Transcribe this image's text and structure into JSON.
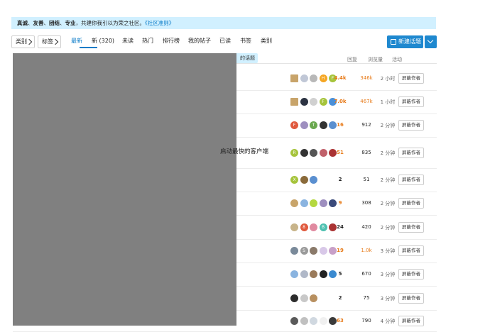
{
  "banner": {
    "w1": "真诚",
    "sep1": "、",
    "w2": "友善",
    "sep2": "、",
    "w3": "团结",
    "sep3": "、",
    "w4": "专业",
    "text": "，共建你我引以为荣之社区。",
    "link": "《社区准则》"
  },
  "nav": {
    "category": "类别",
    "tags": "标签",
    "tabs": [
      "最新",
      "新 (320)",
      "未读",
      "热门",
      "排行榜",
      "我的帖子",
      "已读",
      "书签",
      "类别"
    ],
    "active_tab": "最新"
  },
  "new_topic": "新建话题",
  "hint": "的话题",
  "columns": {
    "replies": "回复",
    "views": "浏览量",
    "activity": "活动"
  },
  "block_label": "屏蔽作者",
  "colors": {
    "accent": "#0a7bc8",
    "hot": "#e77a18",
    "banner_bg": "#d1f0ff",
    "redaction": "#808080"
  },
  "rows": [
    {
      "title": "",
      "replies": "4.4k",
      "views": "346k",
      "activity": "2 小时",
      "replies_hot": true,
      "views_hot": true,
      "avatars": [
        {
          "c": "#c8a46a",
          "t": "",
          "sq": true
        },
        {
          "c": "#c0c7d6",
          "t": ""
        },
        {
          "c": "#b8b8b8",
          "t": ""
        },
        {
          "c": "#f5a623",
          "t": "H"
        },
        {
          "c": "#a6c43c",
          "t": "F"
        }
      ]
    },
    {
      "title": "",
      "replies": "7.0k",
      "views": "467k",
      "activity": "1 小时",
      "replies_hot": true,
      "views_hot": true,
      "avatars": [
        {
          "c": "#c8a46a",
          "t": "",
          "sq": true
        },
        {
          "c": "#2c3342",
          "t": ""
        },
        {
          "c": "#d0d0d0",
          "t": ""
        },
        {
          "c": "#a6c43c",
          "t": "F"
        },
        {
          "c": "#4a90d9",
          "t": ""
        }
      ]
    },
    {
      "title": "",
      "replies": "16",
      "views": "912",
      "activity": "2 分钟",
      "replies_hot": true,
      "views_hot": false,
      "avatars": [
        {
          "c": "#e05a3e",
          "t": "F"
        },
        {
          "c": "#9e8fbf",
          "t": ""
        },
        {
          "c": "#6aa84f",
          "t": "T"
        },
        {
          "c": "#333333",
          "t": ""
        },
        {
          "c": "#5a8fd0",
          "t": ""
        }
      ]
    },
    {
      "title": "启动最快的客户端",
      "replies": "51",
      "views": "835",
      "activity": "2 分钟",
      "replies_hot": true,
      "views_hot": false,
      "avatars": [
        {
          "c": "#a6c43c",
          "t": "R"
        },
        {
          "c": "#333333",
          "t": ""
        },
        {
          "c": "#555555",
          "t": ""
        },
        {
          "c": "#c0606a",
          "t": ""
        },
        {
          "c": "#aa3333",
          "t": ""
        }
      ]
    },
    {
      "title": "",
      "replies": "2",
      "views": "51",
      "activity": "2 分钟",
      "replies_hot": false,
      "views_hot": false,
      "avatars": [
        {
          "c": "#a6c43c",
          "t": "X"
        },
        {
          "c": "#8a6a3a",
          "t": ""
        },
        {
          "c": "#5a8fd0",
          "t": ""
        }
      ]
    },
    {
      "title": "",
      "replies": "9",
      "views": "308",
      "activity": "2 分钟",
      "replies_hot": true,
      "views_hot": false,
      "avatars": [
        {
          "c": "#c8a46a",
          "t": ""
        },
        {
          "c": "#8ab4e0",
          "t": ""
        },
        {
          "c": "#b5d840",
          "t": ""
        },
        {
          "c": "#9e8fbf",
          "t": ""
        },
        {
          "c": "#3a4a7a",
          "t": ""
        }
      ]
    },
    {
      "title": "",
      "replies": "24",
      "views": "420",
      "activity": "2 分钟",
      "replies_hot": false,
      "views_hot": false,
      "avatars": [
        {
          "c": "#c8b48a",
          "t": ""
        },
        {
          "c": "#e05a3e",
          "t": "8"
        },
        {
          "c": "#e08aa0",
          "t": ""
        },
        {
          "c": "#4ec0b0",
          "t": "B"
        },
        {
          "c": "#aa3333",
          "t": ""
        }
      ]
    },
    {
      "title": "",
      "replies": "19",
      "views": "1.0k",
      "activity": "3 分钟",
      "replies_hot": true,
      "views_hot": true,
      "avatars": [
        {
          "c": "#7a8a9a",
          "t": ""
        },
        {
          "c": "#9a9a9a",
          "t": "S"
        },
        {
          "c": "#8a7a6a",
          "t": ""
        },
        {
          "c": "#d8c8e8",
          "t": ""
        },
        {
          "c": "#c8a0c8",
          "t": ""
        }
      ]
    },
    {
      "title": "",
      "replies": "5",
      "views": "670",
      "activity": "3 分钟",
      "replies_hot": false,
      "views_hot": false,
      "avatars": [
        {
          "c": "#8ab4e0",
          "t": ""
        },
        {
          "c": "#b0b8c8",
          "t": ""
        },
        {
          "c": "#9a7a5a",
          "t": ""
        },
        {
          "c": "#222222",
          "t": ""
        },
        {
          "c": "#3a8ad0",
          "t": ""
        }
      ]
    },
    {
      "title": "",
      "replies": "2",
      "views": "75",
      "activity": "3 分钟",
      "replies_hot": false,
      "views_hot": false,
      "avatars": [
        {
          "c": "#2c2c2c",
          "t": ""
        },
        {
          "c": "#c8c8c8",
          "t": ""
        },
        {
          "c": "#b89060",
          "t": ""
        }
      ]
    },
    {
      "title": "",
      "replies": "63",
      "views": "790",
      "activity": "4 分钟",
      "replies_hot": true,
      "views_hot": false,
      "avatars": [
        {
          "c": "#5a5a5a",
          "t": ""
        },
        {
          "c": "#c0c0c0",
          "t": ""
        },
        {
          "c": "#d0d8e0",
          "t": ""
        },
        {
          "c": "#f0f0f0",
          "t": ""
        },
        {
          "c": "#3a3a3a",
          "t": ""
        }
      ]
    }
  ]
}
